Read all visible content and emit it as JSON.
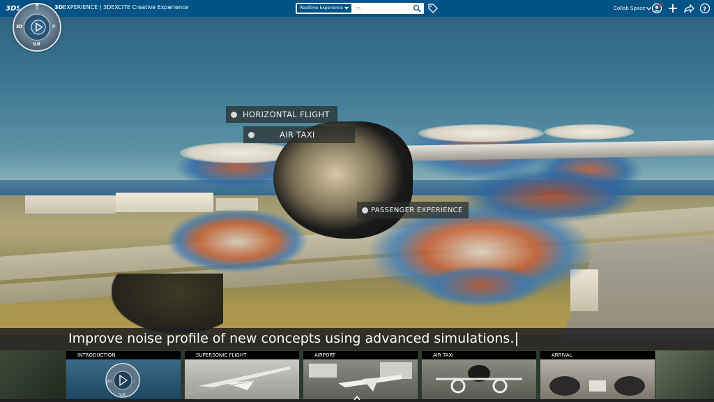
{
  "header": {
    "brand_logo": "3DS",
    "app_brand": "3D",
    "app_name": "EXPERIENCE",
    "app_suffix": " | 3DEXCITE Creative Experience",
    "search_filter": "Realtime Experience",
    "search_placeholder": "rh",
    "collab_space": "Collab Space",
    "icons": [
      "search-icon",
      "tag-icon",
      "user-icon",
      "plus-icon",
      "share-icon",
      "help-icon"
    ]
  },
  "compass": {
    "label_3d": "3D",
    "label_i": "i³",
    "label_vr": "V,R"
  },
  "hotspots": [
    {
      "label": "HORIZONTAL FLIGHT"
    },
    {
      "label": "AIR TAXI"
    },
    {
      "label": "PASSENGER EXPERIENCE"
    }
  ],
  "caption": "Improve noise profile of new concepts using advanced simulations.",
  "chapters": [
    {
      "label": "INTRODUCTION"
    },
    {
      "label": "SUPERSONIC FLIGHT"
    },
    {
      "label": "AIRPORT"
    },
    {
      "label": "AIR TAXI"
    },
    {
      "label": "ARRIVAL"
    }
  ],
  "colors": {
    "topbar": "#005386",
    "caption_bar": "#1e2022",
    "hotspot_bg": "#282d2d"
  }
}
